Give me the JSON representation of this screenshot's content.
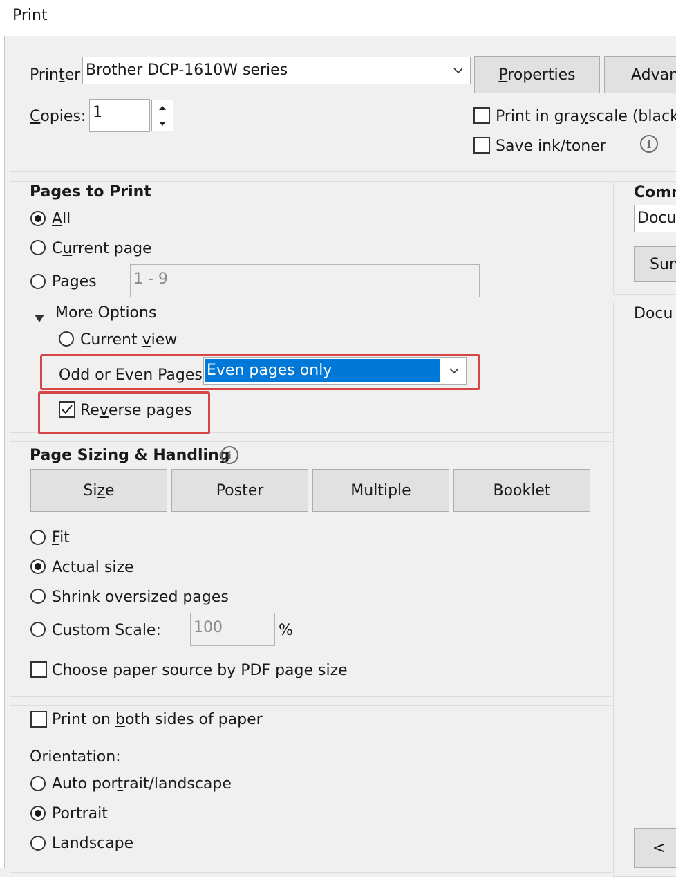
{
  "window": {
    "title": "Print"
  },
  "printer": {
    "label": "Printer:",
    "selected": "Brother DCP-1610W series",
    "properties_button": "Properties",
    "advanced_button": "Advan"
  },
  "copies": {
    "label": "Copies:",
    "value": "1"
  },
  "options": {
    "grayscale_label": "Print in grayscale (black a",
    "grayscale_checked": false,
    "save_ink_label": "Save ink/toner",
    "save_ink_checked": false
  },
  "pages_to_print": {
    "heading": "Pages to Print",
    "all_label": "All",
    "current_page_label": "Current page",
    "pages_label": "Pages",
    "pages_range_placeholder": "1 - 9",
    "selected": "All",
    "more_options_label": "More Options",
    "current_view_label": "Current view",
    "odd_even_label": "Odd or Even Pages:",
    "odd_even_value": "Even pages only",
    "reverse_label": "Reverse pages",
    "reverse_checked": true
  },
  "page_sizing": {
    "heading": "Page Sizing & Handling",
    "tabs": [
      "Size",
      "Poster",
      "Multiple",
      "Booklet"
    ],
    "fit_label": "Fit",
    "actual_size_label": "Actual size",
    "shrink_label": "Shrink oversized pages",
    "custom_scale_label": "Custom Scale:",
    "custom_scale_value": "100",
    "percent": "%",
    "selected": "Actual size",
    "paper_source_label": "Choose paper source by PDF page size",
    "paper_source_checked": false
  },
  "duplex": {
    "label": "Print on both sides of paper",
    "checked": false
  },
  "orientation": {
    "heading": "Orientation:",
    "auto_label": "Auto portrait/landscape",
    "portrait_label": "Portrait",
    "landscape_label": "Landscape",
    "selected": "Portrait"
  },
  "comments": {
    "heading": "Comm",
    "select_value": "Docu",
    "summarize_button": "Sun",
    "preview_label": "Docu",
    "prev_button": "<"
  }
}
